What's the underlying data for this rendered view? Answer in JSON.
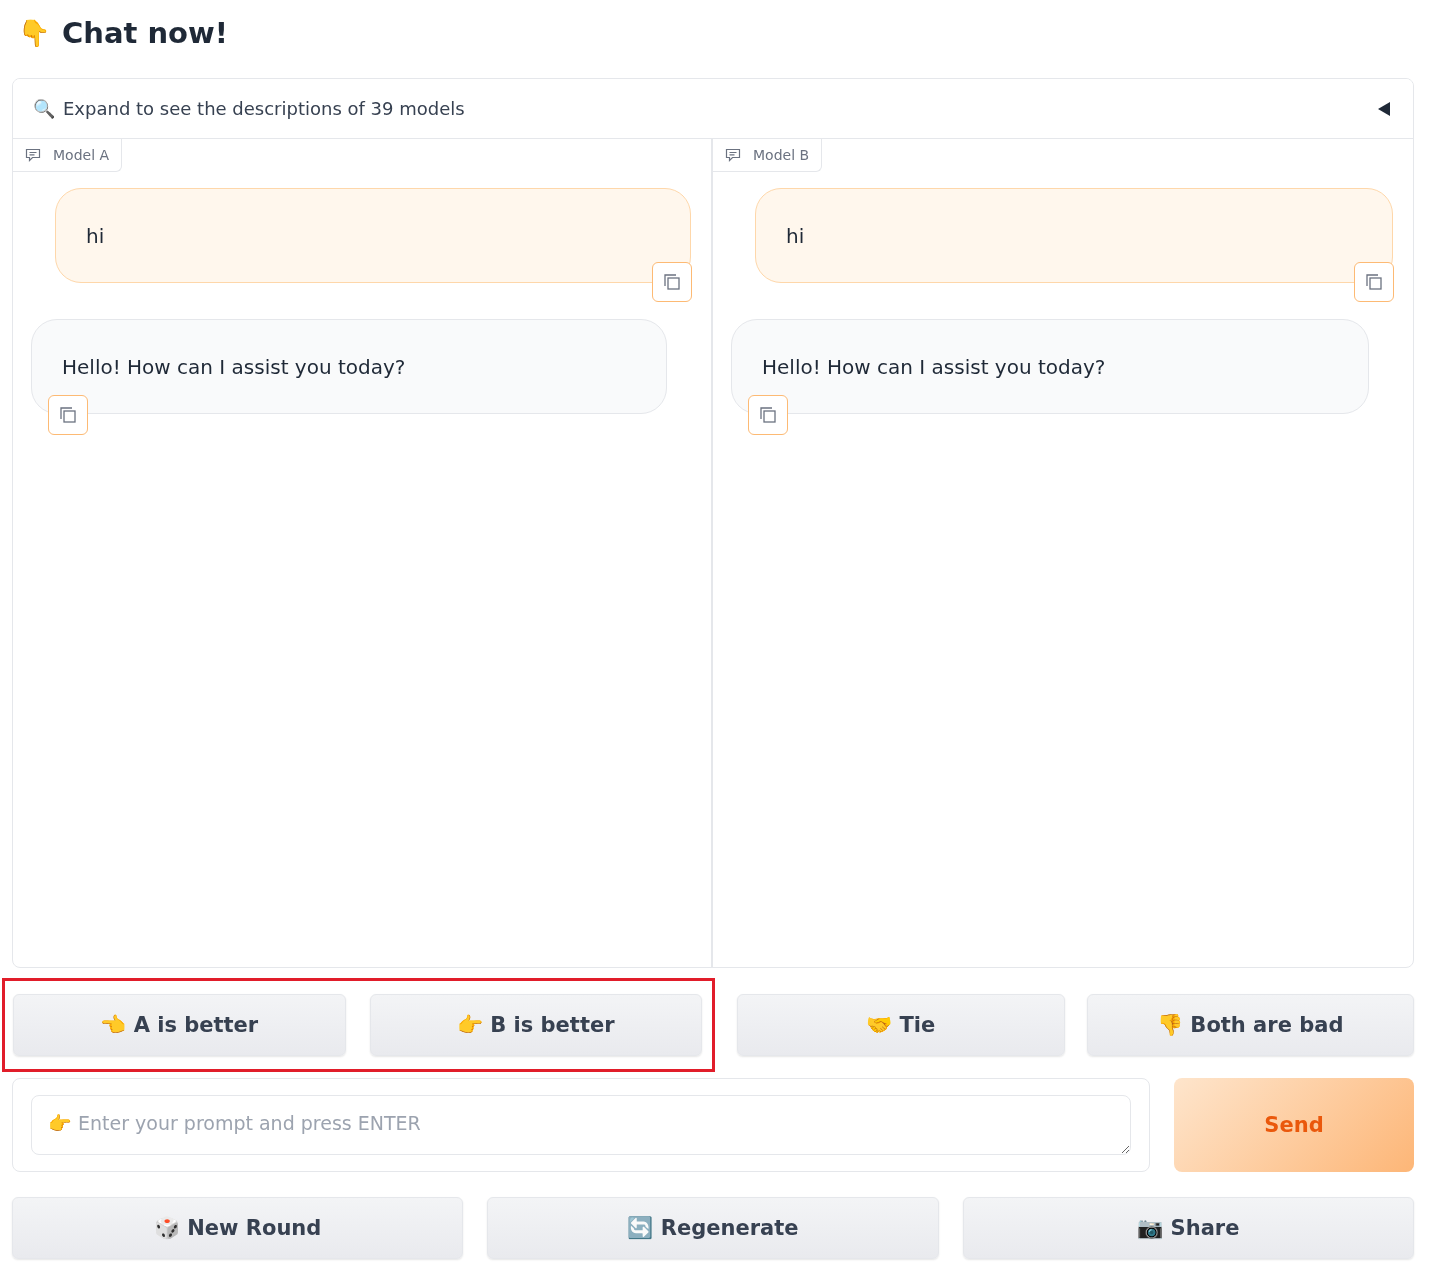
{
  "heading": {
    "emoji": "👇",
    "title": "Chat now!"
  },
  "accordion": {
    "emoji": "🔍",
    "label": "Expand to see the descriptions of 39 models",
    "expanded": false
  },
  "chats": [
    {
      "label": "Model A",
      "messages": [
        {
          "kind": "user",
          "text": "hi"
        },
        {
          "kind": "bot",
          "text": "Hello! How can I assist you today?"
        }
      ]
    },
    {
      "label": "Model B",
      "messages": [
        {
          "kind": "user",
          "text": "hi"
        },
        {
          "kind": "bot",
          "text": "Hello! How can I assist you today?"
        }
      ]
    }
  ],
  "vote_groups": [
    {
      "highlighted": true,
      "buttons": [
        "👈 A is better",
        "👉 B is better"
      ]
    },
    {
      "highlighted": false,
      "buttons": [
        "🤝 Tie",
        "👎 Both are bad"
      ]
    }
  ],
  "prompt": {
    "placeholder": "👉 Enter your prompt and press ENTER"
  },
  "send_button": "Send",
  "action_buttons": [
    "🎲 New Round",
    "🔄 Regenerate",
    "📷 Share"
  ]
}
